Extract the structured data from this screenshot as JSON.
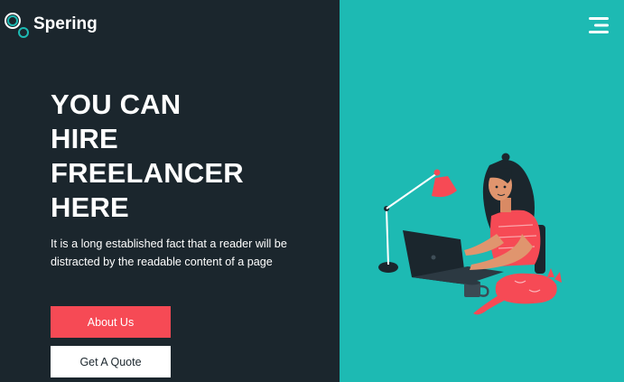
{
  "header": {
    "brand": "Spering",
    "logo_icon": "interlocking-circles-logo",
    "menu_icon": "hamburger-menu-icon"
  },
  "hero": {
    "headline_lines": [
      "YOU CAN",
      "HIRE",
      "FREELANCER",
      "HERE"
    ],
    "description": "It is a long established fact that a reader will be distracted by the readable content of a page",
    "about_button_label": "About Us",
    "quote_button_label": "Get A Quote",
    "illustration": "woman-working-on-laptop-with-desk-lamp-and-cat"
  },
  "colors": {
    "dark_panel": "#1b262d",
    "teal_panel": "#1dbab3",
    "accent_red": "#f64a55",
    "white": "#ffffff"
  }
}
